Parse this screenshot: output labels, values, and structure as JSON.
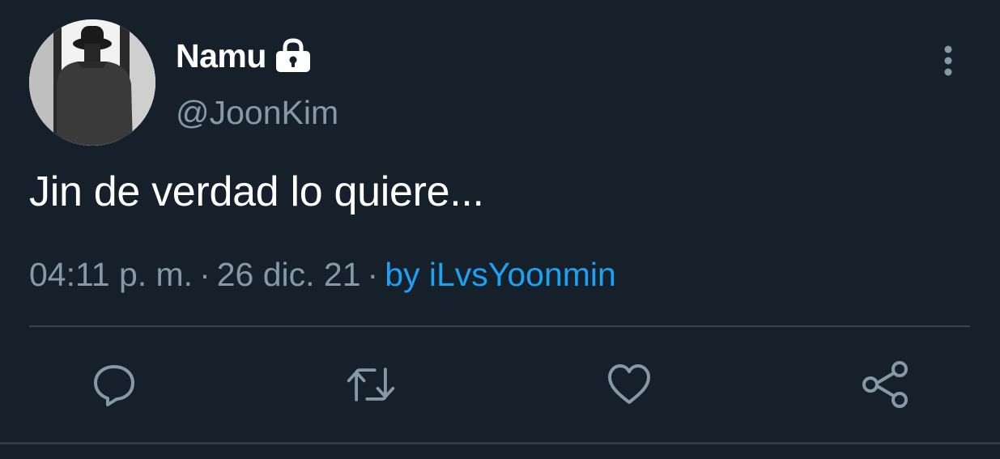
{
  "author": {
    "display_name": "Namu",
    "handle": "@JoonKim",
    "protected_icon": "lock-icon"
  },
  "tweet": {
    "text": "Jin de verdad lo quiere...",
    "time": "04:11 p. m.",
    "separator": "·",
    "date": "26 dic. 21",
    "source": "by iLvsYoonmin"
  },
  "actions": [
    {
      "name": "reply",
      "icon": "comment-icon"
    },
    {
      "name": "retweet",
      "icon": "retweet-icon"
    },
    {
      "name": "like",
      "icon": "heart-icon"
    },
    {
      "name": "share",
      "icon": "share-icon"
    }
  ],
  "colors": {
    "background": "#15202b",
    "text_primary": "#ffffff",
    "text_secondary": "#8899a6",
    "accent": "#1da1f2",
    "divider": "#38444d"
  }
}
